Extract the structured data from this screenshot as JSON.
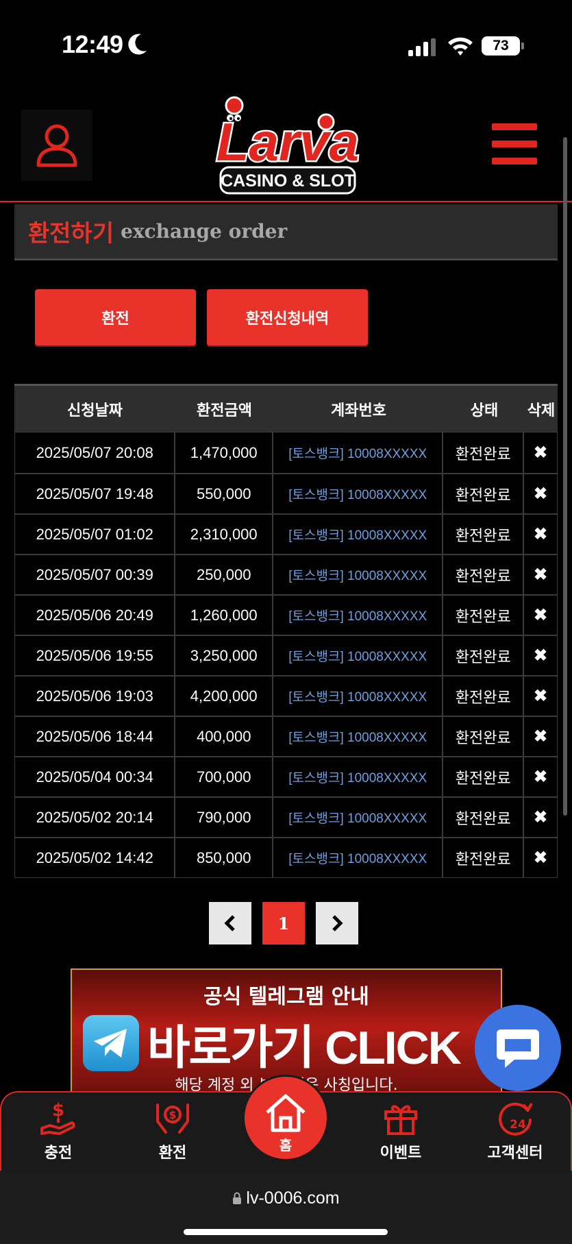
{
  "status_bar": {
    "time": "12:49",
    "battery": "73"
  },
  "header": {
    "logo_word": "Larva",
    "logo_tagline": "CASINO & SLOT"
  },
  "page_title": {
    "korean": "환전하기",
    "english": "exchange order"
  },
  "tabs": [
    {
      "label": "환전"
    },
    {
      "label": "환전신청내역"
    }
  ],
  "table": {
    "headers": [
      "신청날짜",
      "환전금액",
      "계좌번호",
      "상태",
      "삭제"
    ],
    "rows": [
      {
        "date": "2025/05/07 20:08",
        "amount": "1,470,000",
        "account": "[토스뱅크] 10008XXXXX",
        "status": "환전완료",
        "delete": "✖"
      },
      {
        "date": "2025/05/07 19:48",
        "amount": "550,000",
        "account": "[토스뱅크] 10008XXXXX",
        "status": "환전완료",
        "delete": "✖"
      },
      {
        "date": "2025/05/07 01:02",
        "amount": "2,310,000",
        "account": "[토스뱅크] 10008XXXXX",
        "status": "환전완료",
        "delete": "✖"
      },
      {
        "date": "2025/05/07 00:39",
        "amount": "250,000",
        "account": "[토스뱅크] 10008XXXXX",
        "status": "환전완료",
        "delete": "✖"
      },
      {
        "date": "2025/05/06 20:49",
        "amount": "1,260,000",
        "account": "[토스뱅크] 10008XXXXX",
        "status": "환전완료",
        "delete": "✖"
      },
      {
        "date": "2025/05/06 19:55",
        "amount": "3,250,000",
        "account": "[토스뱅크] 10008XXXXX",
        "status": "환전완료",
        "delete": "✖"
      },
      {
        "date": "2025/05/06 19:03",
        "amount": "4,200,000",
        "account": "[토스뱅크] 10008XXXXX",
        "status": "환전완료",
        "delete": "✖"
      },
      {
        "date": "2025/05/06 18:44",
        "amount": "400,000",
        "account": "[토스뱅크] 10008XXXXX",
        "status": "환전완료",
        "delete": "✖"
      },
      {
        "date": "2025/05/04 00:34",
        "amount": "700,000",
        "account": "[토스뱅크] 10008XXXXX",
        "status": "환전완료",
        "delete": "✖"
      },
      {
        "date": "2025/05/02 20:14",
        "amount": "790,000",
        "account": "[토스뱅크] 10008XXXXX",
        "status": "환전완료",
        "delete": "✖"
      },
      {
        "date": "2025/05/02 14:42",
        "amount": "850,000",
        "account": "[토스뱅크] 10008XXXXX",
        "status": "환전완료",
        "delete": "✖"
      }
    ]
  },
  "pagination": {
    "prev": "‹",
    "current": "1",
    "next": "›"
  },
  "banner": {
    "top_text": "공식 텔레그램 안내",
    "main_text": "바로가기 CLICK",
    "sub_text": "해당 계정 외 본 채널은 사칭입니다."
  },
  "bottom_nav": [
    {
      "label": "충전",
      "icon": "deposit-hand-icon"
    },
    {
      "label": "환전",
      "icon": "exchange-hands-icon"
    },
    {
      "label": "홈",
      "icon": "home-icon"
    },
    {
      "label": "이벤트",
      "icon": "gift-icon"
    },
    {
      "label": "고객센터",
      "icon": "24h-support-icon"
    }
  ],
  "browser": {
    "url": "lv-0006.com"
  },
  "colors": {
    "accent": "#e9322a",
    "account_link": "#6e9fe0",
    "background": "#000000",
    "chat": "#3b73e0"
  }
}
